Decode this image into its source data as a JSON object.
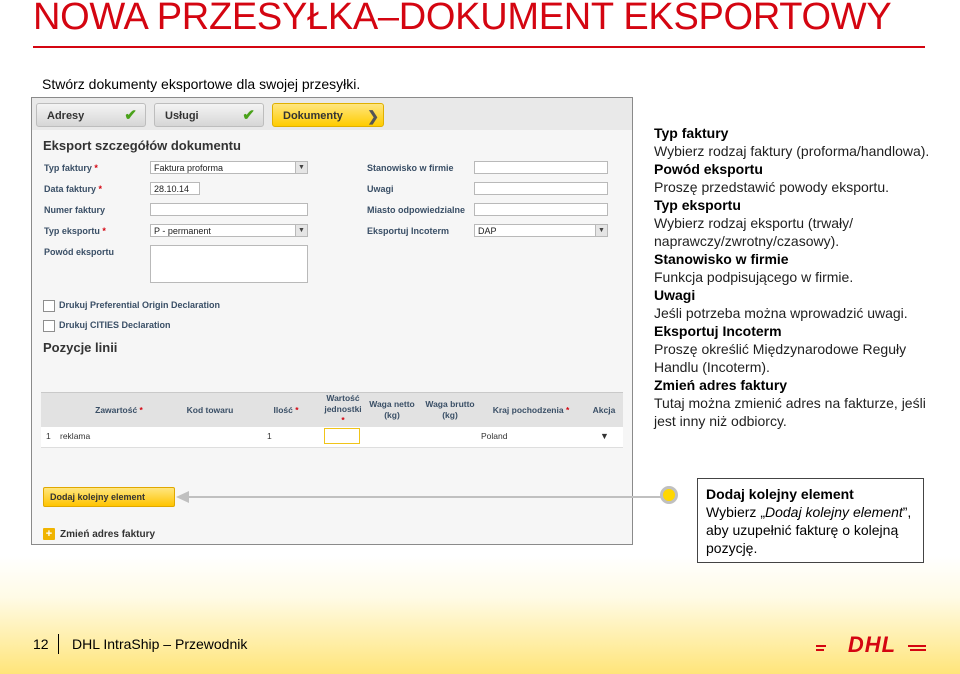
{
  "page": {
    "title": "NOWA PRZESYŁKA–DOKUMENT EKSPORTOWY",
    "subtitle": "Stwórz dokumenty eksportowe dla swojej przesyłki."
  },
  "app": {
    "tabs": [
      {
        "label": "Adresy",
        "state": "done"
      },
      {
        "label": "Usługi",
        "state": "done"
      },
      {
        "label": "Dokumenty",
        "state": "active"
      }
    ],
    "section_title": "Eksport szczegółów dokumentu",
    "left_fields": [
      {
        "label": "Typ faktury",
        "required": "*",
        "value": "Faktura proforma",
        "type": "select"
      },
      {
        "label": "Data faktury",
        "required": "*",
        "value": "28.10.14",
        "type": "text"
      },
      {
        "label": "Numer faktury",
        "required": "",
        "value": "",
        "type": "text"
      },
      {
        "label": "Typ eksportu",
        "required": "*",
        "value": "P - permanent",
        "type": "select"
      },
      {
        "label": "Powód eksportu",
        "required": "",
        "value": "",
        "type": "textarea"
      }
    ],
    "right_fields": [
      {
        "label": "Stanowisko w firmie",
        "value": "",
        "type": "text"
      },
      {
        "label": "Uwagi",
        "value": "",
        "type": "text"
      },
      {
        "label": "Miasto odpowiedzialne",
        "value": "",
        "type": "text"
      },
      {
        "label": "Eksportuj Incoterm",
        "value": "DAP",
        "type": "select"
      }
    ],
    "checkboxes": [
      {
        "label": "Drukuj Preferential Origin Declaration",
        "checked": false
      },
      {
        "label": "Drukuj CITIES Declaration",
        "checked": false
      }
    ],
    "lines_title": "Pozycje linii",
    "table": {
      "headers": [
        {
          "text": "Zawartość",
          "req": "*"
        },
        {
          "text": "Kod towaru",
          "req": ""
        },
        {
          "text": "Ilość",
          "req": "*"
        },
        {
          "text": "Wartość jednostki",
          "req": "*"
        },
        {
          "text": "Waga netto (kg)",
          "req": ""
        },
        {
          "text": "Waga brutto (kg)",
          "req": ""
        },
        {
          "text": "Kraj pochodzenia",
          "req": "*"
        },
        {
          "text": "Akcja",
          "req": ""
        }
      ],
      "rows": [
        {
          "num": "1",
          "content": "reklama",
          "code": "",
          "qty": "1",
          "unit_value": "",
          "net": "",
          "gross": "",
          "country": "Poland",
          "action": "▼"
        }
      ]
    },
    "add_button": "Dodaj kolejny element",
    "change_address": "Zmień adres faktury"
  },
  "descriptions": [
    {
      "term": "Typ faktury",
      "text": "Wybierz rodzaj faktury (proforma/handlowa)."
    },
    {
      "term": "Powód eksportu",
      "text": "Proszę przedstawić powody eksportu."
    },
    {
      "term": "Typ eksportu",
      "text": "Wybierz rodzaj eksportu (trwały/ naprawczy/zwrotny/czasowy)."
    },
    {
      "term": "Stanowisko w firmie",
      "text": "Funkcja podpisującego w firmie."
    },
    {
      "term": "Uwagi",
      "text": "Jeśli potrzeba można wprowadzić uwagi."
    },
    {
      "term": "Eksportuj Incoterm",
      "text": "Proszę określić Międzynarodowe Reguły Handlu (Incoterm)."
    },
    {
      "term": "Zmień adres faktury",
      "text": "Tutaj można zmienić adres na fakturze, jeśli jest inny niż odbiorcy."
    }
  ],
  "callout": {
    "title": "Dodaj kolejny element",
    "text_before": "Wybierz „",
    "text_italic": "Dodaj kolejny element",
    "text_after": "”, aby uzupełnić fakturę o kolejną pozycję."
  },
  "footer": {
    "page_number": "12",
    "text": "DHL IntraShip – Przewodnik",
    "logo_text": "DHL"
  },
  "colors": {
    "dhl_red": "#d40511",
    "dhl_yellow": "#ffcc00"
  }
}
